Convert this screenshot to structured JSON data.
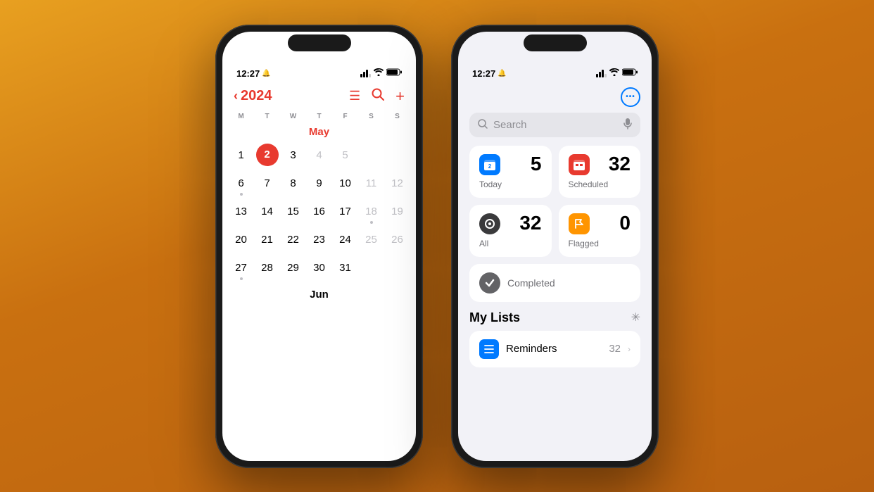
{
  "background": "#c97010",
  "phone_left": {
    "status": {
      "time": "12:27",
      "bell": "🔔",
      "signal": "▮▮▮",
      "wifi": "wifi",
      "battery": "🔋"
    },
    "app": "Calendar",
    "header": {
      "back_year": "2024",
      "icons": [
        "list-icon",
        "search-icon",
        "plus-icon"
      ]
    },
    "weekdays": [
      "M",
      "T",
      "W",
      "T",
      "F",
      "S",
      "S"
    ],
    "month_label": "May",
    "weeks": [
      [
        {
          "day": "1",
          "muted": false,
          "today": false,
          "dot": false
        },
        {
          "day": "2",
          "muted": false,
          "today": true,
          "dot": false
        },
        {
          "day": "3",
          "muted": false,
          "today": false,
          "dot": false
        },
        {
          "day": "4",
          "muted": false,
          "today": false,
          "dot": false
        },
        {
          "day": "5",
          "muted": false,
          "today": false,
          "dot": false
        },
        {
          "day": "",
          "muted": true,
          "today": false,
          "dot": false
        },
        {
          "day": "",
          "muted": true,
          "today": false,
          "dot": false
        }
      ],
      [
        {
          "day": "6",
          "muted": false,
          "today": false,
          "dot": true
        },
        {
          "day": "7",
          "muted": false,
          "today": false,
          "dot": false
        },
        {
          "day": "8",
          "muted": false,
          "today": false,
          "dot": false
        },
        {
          "day": "9",
          "muted": false,
          "today": false,
          "dot": false
        },
        {
          "day": "10",
          "muted": false,
          "today": false,
          "dot": false
        },
        {
          "day": "11",
          "muted": false,
          "today": false,
          "dot": false
        },
        {
          "day": "12",
          "muted": false,
          "today": false,
          "dot": false
        }
      ],
      [
        {
          "day": "13",
          "muted": false,
          "today": false,
          "dot": false
        },
        {
          "day": "14",
          "muted": false,
          "today": false,
          "dot": false
        },
        {
          "day": "15",
          "muted": false,
          "today": false,
          "dot": false
        },
        {
          "day": "16",
          "muted": false,
          "today": false,
          "dot": false
        },
        {
          "day": "17",
          "muted": false,
          "today": false,
          "dot": false
        },
        {
          "day": "18",
          "muted": false,
          "today": false,
          "dot": true
        },
        {
          "day": "19",
          "muted": false,
          "today": false,
          "dot": false
        }
      ],
      [
        {
          "day": "20",
          "muted": false,
          "today": false,
          "dot": false
        },
        {
          "day": "21",
          "muted": false,
          "today": false,
          "dot": false
        },
        {
          "day": "22",
          "muted": false,
          "today": false,
          "dot": false
        },
        {
          "day": "23",
          "muted": false,
          "today": false,
          "dot": false
        },
        {
          "day": "24",
          "muted": false,
          "today": false,
          "dot": false
        },
        {
          "day": "25",
          "muted": true,
          "today": false,
          "dot": false
        },
        {
          "day": "26",
          "muted": true,
          "today": false,
          "dot": false
        }
      ],
      [
        {
          "day": "27",
          "muted": false,
          "today": false,
          "dot": true
        },
        {
          "day": "28",
          "muted": false,
          "today": false,
          "dot": false
        },
        {
          "day": "29",
          "muted": false,
          "today": false,
          "dot": false
        },
        {
          "day": "30",
          "muted": false,
          "today": false,
          "dot": false
        },
        {
          "day": "31",
          "muted": false,
          "today": false,
          "dot": false
        },
        {
          "day": "",
          "muted": true,
          "today": false,
          "dot": false
        },
        {
          "day": "",
          "muted": true,
          "today": false,
          "dot": false
        }
      ]
    ],
    "next_month": "Jun"
  },
  "phone_right": {
    "status": {
      "time": "12:27",
      "bell": "🔔"
    },
    "app": "Reminders",
    "more_button": "•••",
    "search_placeholder": "Search",
    "cards": [
      {
        "id": "today",
        "icon": "📅",
        "icon_style": "blue",
        "count": "5",
        "label": "Today"
      },
      {
        "id": "scheduled",
        "icon": "📅",
        "icon_style": "red",
        "count": "32",
        "label": "Scheduled"
      },
      {
        "id": "all",
        "icon": "⊙",
        "icon_style": "dark",
        "count": "32",
        "label": "All"
      },
      {
        "id": "flagged",
        "icon": "⚑",
        "icon_style": "orange",
        "count": "0",
        "label": "Flagged"
      }
    ],
    "completed_label": "Completed",
    "my_lists_title": "My Lists",
    "lists": [
      {
        "name": "Reminders",
        "count": "32",
        "icon": "≡",
        "icon_color": "#007aff"
      }
    ]
  }
}
